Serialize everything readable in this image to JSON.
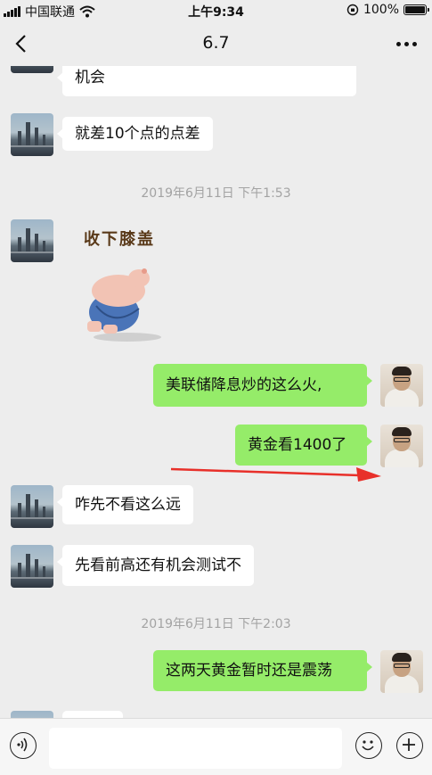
{
  "status_bar": {
    "carrier": "中国联通",
    "time": "上午9:34",
    "battery": "100%"
  },
  "header": {
    "title": "6.7"
  },
  "messages": [
    {
      "side": "in",
      "text": "机会"
    },
    {
      "side": "in",
      "text": "就差10个点的点差"
    },
    {
      "type": "timestamp",
      "text": "2019年6月11日 下午1:53"
    },
    {
      "side": "in",
      "type": "sticker",
      "text": "收下膝盖"
    },
    {
      "side": "out",
      "text": "美联储降息炒的这么火,"
    },
    {
      "side": "out",
      "text": "黄金看1400了"
    },
    {
      "side": "in",
      "text": "咋先不看这么远"
    },
    {
      "side": "in",
      "text": "先看前高还有机会测试不"
    },
    {
      "type": "timestamp",
      "text": "2019年6月11日 下午2:03"
    },
    {
      "side": "out",
      "text": "这两天黄金暂时还是震荡"
    }
  ],
  "annotation": {
    "arrow_color": "#e8302a"
  },
  "colors": {
    "background": "#ededed",
    "outgoing_bubble": "#95ec69",
    "incoming_bubble": "#ffffff",
    "timestamp": "#a3a3a3"
  },
  "icons": {
    "voice": "voice-icon",
    "emoji": "emoji-icon",
    "add": "plus-icon",
    "back": "back-icon",
    "more": "more-icon"
  }
}
